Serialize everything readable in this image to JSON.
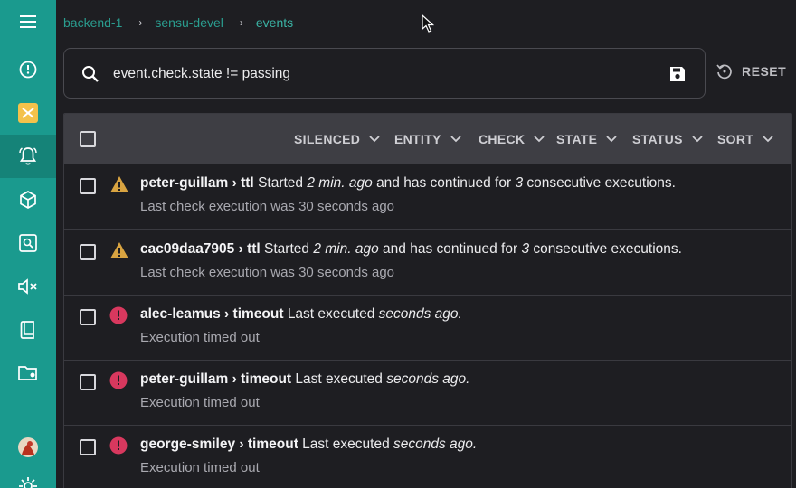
{
  "sidebar": {
    "items": [
      {
        "name": "menu",
        "icon": "hamburger-icon"
      },
      {
        "name": "dashboard",
        "icon": "gauge-icon"
      },
      {
        "name": "namespace",
        "icon": "namespace-badge-icon"
      },
      {
        "name": "events",
        "icon": "bell-alert-icon"
      },
      {
        "name": "entities",
        "icon": "cube-icon"
      },
      {
        "name": "checks",
        "icon": "monitor-search-icon"
      },
      {
        "name": "silences",
        "icon": "speaker-mute-icon"
      },
      {
        "name": "handlers",
        "icon": "book-icon"
      },
      {
        "name": "configuration",
        "icon": "folder-gear-icon"
      },
      {
        "name": "user",
        "icon": "avatar"
      },
      {
        "name": "settings",
        "icon": "gear-icon"
      }
    ],
    "accent": "#1a9a8e"
  },
  "breadcrumb": {
    "items": [
      "backend-1",
      "sensu-devel",
      "events"
    ],
    "separator": "›"
  },
  "search": {
    "value": "event.check.state != passing"
  },
  "reset_label": "RESET",
  "table": {
    "filters": [
      "SILENCED",
      "ENTITY",
      "CHECK",
      "STATE",
      "STATUS",
      "SORT"
    ],
    "rows": [
      {
        "status": "warning",
        "entity": "peter-guillam",
        "check": "ttl",
        "text_a": "Started",
        "time": "2 min. ago",
        "text_b": "and has continued for",
        "count": "3",
        "text_c": "consecutive executions.",
        "detail": "Last check execution was 30 seconds ago"
      },
      {
        "status": "warning",
        "entity": "cac09daa7905",
        "check": "ttl",
        "text_a": "Started",
        "time": "2 min. ago",
        "text_b": "and has continued for",
        "count": "3",
        "text_c": "consecutive executions.",
        "detail": "Last check execution was 30 seconds ago"
      },
      {
        "status": "critical",
        "entity": "alec-leamus",
        "check": "timeout",
        "text_a": "Last executed",
        "time": "seconds ago.",
        "detail": "Execution timed out"
      },
      {
        "status": "critical",
        "entity": "peter-guillam",
        "check": "timeout",
        "text_a": "Last executed",
        "time": "seconds ago.",
        "detail": "Execution timed out"
      },
      {
        "status": "critical",
        "entity": "george-smiley",
        "check": "timeout",
        "text_a": "Last executed",
        "time": "seconds ago.",
        "detail": "Execution timed out"
      }
    ]
  },
  "colors": {
    "warning": "#d9a441",
    "critical": "#d8385e",
    "link": "#2a9d8f"
  }
}
